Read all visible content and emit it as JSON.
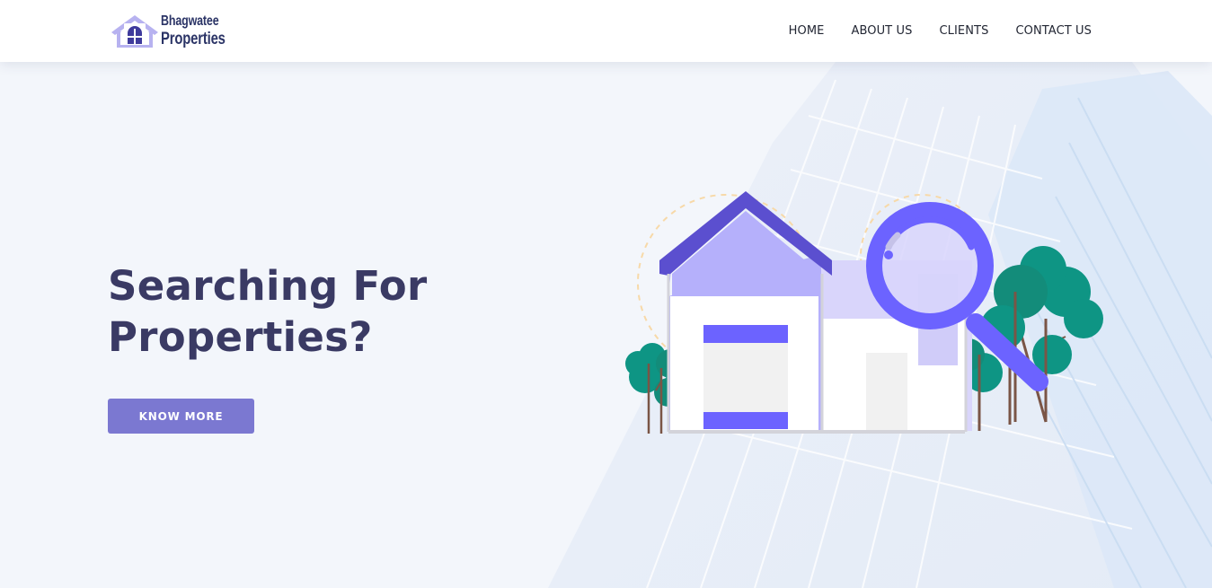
{
  "brand": {
    "name_line1": "Bhagwatee",
    "name_line2": "Properties",
    "logo_icon": "house-icon"
  },
  "nav": {
    "items": [
      {
        "label": "HOME"
      },
      {
        "label": "ABOUT US"
      },
      {
        "label": "CLIENTS"
      },
      {
        "label": "CONTACT US"
      }
    ]
  },
  "hero": {
    "title_line1": "Searching For",
    "title_line2": "Properties?",
    "cta_label": "KNOW MORE",
    "illustration": "house-search-illustration"
  },
  "colors": {
    "accent": "#7b78d1",
    "title": "#3a3a64",
    "magnifier": "#6c63ff",
    "roof": "#5b4fcf",
    "tree": "#0e9584"
  }
}
